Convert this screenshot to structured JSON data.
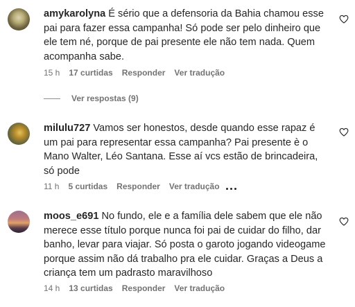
{
  "comments": [
    {
      "username": "amykarolyna",
      "text": "É sério que a defensoria da Bahia chamou esse pai para fazer essa campanha! Só pode ser pelo dinheiro que ele tem né, porque de pai presente ele não tem nada. Quem acompanha sabe.",
      "time": "15 h",
      "likes": "17 curtidas",
      "reply": "Responder",
      "translate": "Ver tradução",
      "view_replies": "Ver respostas (9)"
    },
    {
      "username": "milulu727",
      "text": "Vamos ser honestos, desde quando esse rapaz é um pai para representar essa campanha? Pai presente è o Mano Walter, Léo Santana. Esse aí vcs estão de brincadeira, só pode",
      "time": "11 h",
      "likes": "5 curtidas",
      "reply": "Responder",
      "translate": "Ver tradução"
    },
    {
      "username": "moos_e691",
      "text": "No fundo, ele e a família dele sabem que ele não merece esse título porque nunca foi pai de cuidar do filho, dar banho, levar para viajar. Só posta o garoto jogando videogame porque assim não dá trabalho pra ele cuidar. Graças a Deus a criança tem um padrasto maravilhoso",
      "time": "14 h",
      "likes": "13 curtidas",
      "reply": "Responder",
      "translate": "Ver tradução"
    }
  ],
  "icons": {
    "like": "heart-outline-icon",
    "more": "more-options-icon"
  },
  "colors": {
    "text": "#262626",
    "secondary": "#737373",
    "background": "#ffffff"
  }
}
